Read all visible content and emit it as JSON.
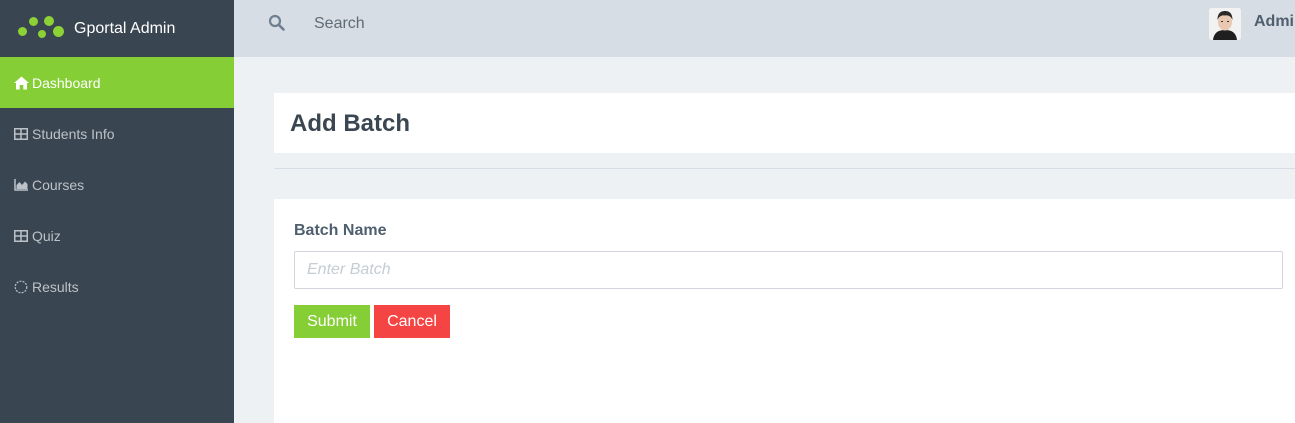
{
  "app": {
    "title": "Gportal Admin"
  },
  "colors": {
    "sidebar_bg": "#394550",
    "accent": "#85ce36",
    "danger": "#f44444",
    "topbar_bg": "#d7dde4"
  },
  "sidebar": {
    "items": [
      {
        "label": "Dashboard",
        "icon": "home-icon",
        "active": true
      },
      {
        "label": "Students Info",
        "icon": "table-icon",
        "active": false
      },
      {
        "label": "Courses",
        "icon": "area-chart-icon",
        "active": false
      },
      {
        "label": "Quiz",
        "icon": "table-icon",
        "active": false
      },
      {
        "label": "Results",
        "icon": "circle-notch-icon",
        "active": false
      }
    ]
  },
  "header": {
    "search": {
      "placeholder": "Search",
      "icon": "search-icon"
    },
    "user": {
      "name": "Admi"
    }
  },
  "page": {
    "title": "Add Batch"
  },
  "form": {
    "batch_name_label": "Batch Name",
    "batch_name_placeholder": "Enter Batch",
    "batch_name_value": "",
    "submit_label": "Submit",
    "cancel_label": "Cancel"
  }
}
